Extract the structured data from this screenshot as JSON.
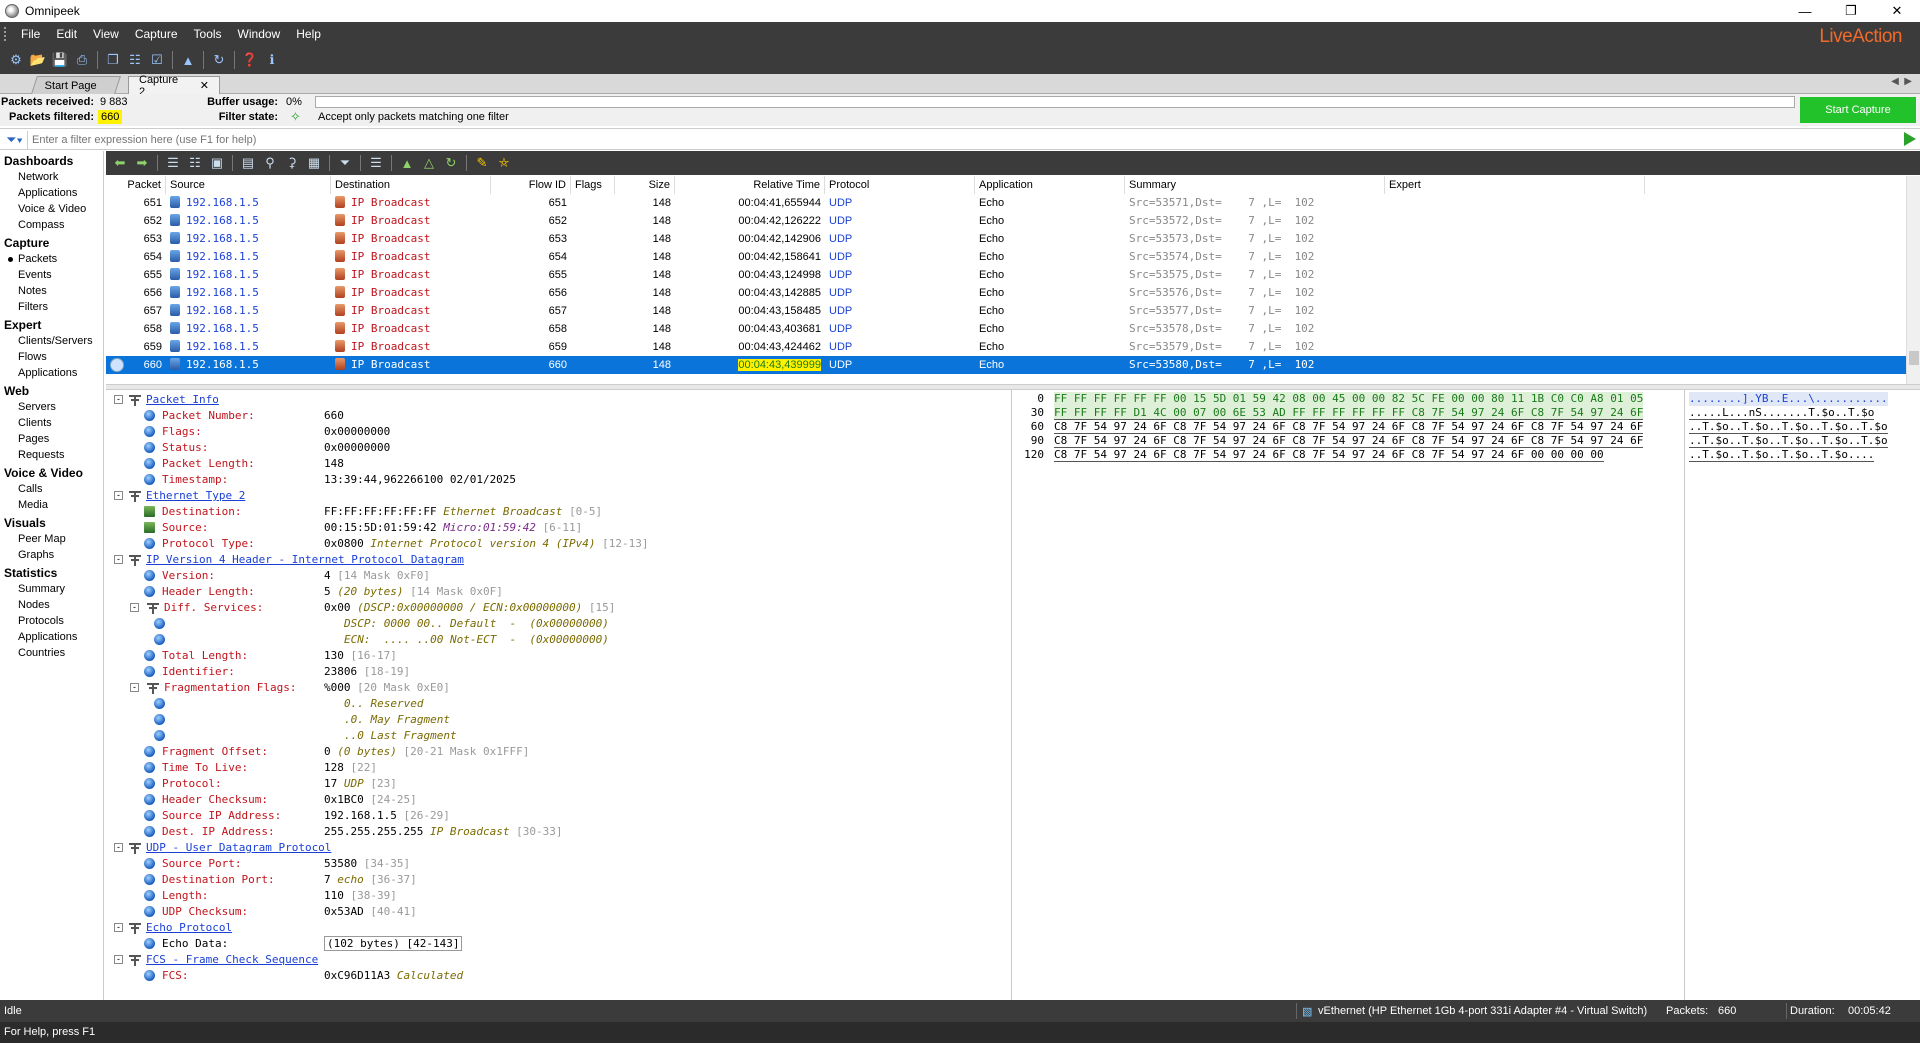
{
  "window": {
    "title": "Omnipeek",
    "brand": "LiveAction"
  },
  "menu": [
    "File",
    "Edit",
    "View",
    "Capture",
    "Tools",
    "Window",
    "Help"
  ],
  "tabs": {
    "start": "Start Page",
    "capture": "Capture 2"
  },
  "stats": {
    "received_label": "Packets received:",
    "received_value": "9 883",
    "filtered_label": "Packets filtered:",
    "filtered_value": "660",
    "buffer_label": "Buffer usage:",
    "buffer_value": "0%",
    "filterstate_label": "Filter state:",
    "filterstate_value": "Accept only packets matching one filter",
    "start_capture": "Start Capture"
  },
  "filter": {
    "placeholder": "Enter a filter expression here (use F1 for help)"
  },
  "sidebar": [
    {
      "section": "Dashboards",
      "items": [
        "Network",
        "Applications",
        "Voice & Video",
        "Compass"
      ]
    },
    {
      "section": "Capture",
      "items": [
        "Packets",
        "Events",
        "Notes",
        "Filters"
      ]
    },
    {
      "section": "Expert",
      "items": [
        "Clients/Servers",
        "Flows",
        "Applications"
      ]
    },
    {
      "section": "Web",
      "items": [
        "Servers",
        "Clients",
        "Pages",
        "Requests"
      ]
    },
    {
      "section": "Voice & Video",
      "items": [
        "Calls",
        "Media"
      ]
    },
    {
      "section": "Visuals",
      "items": [
        "Peer Map",
        "Graphs"
      ]
    },
    {
      "section": "Statistics",
      "items": [
        "Summary",
        "Nodes",
        "Protocols",
        "Applications",
        "Countries"
      ]
    }
  ],
  "sidebar_selected": "Packets",
  "packet_columns": [
    "Packet",
    "Source",
    "Destination",
    "Flow ID",
    "Flags",
    "Size",
    "Relative Time",
    "Protocol",
    "Application",
    "Summary",
    "Expert"
  ],
  "packets": [
    {
      "no": "651",
      "src": "192.168.1.5",
      "dst": "IP Broadcast",
      "flow": "651",
      "size": "148",
      "time": "00:04:41,655944",
      "proto": "UDP",
      "app": "Echo",
      "summary": "Src=53571,Dst=    7 ,L=  102"
    },
    {
      "no": "652",
      "src": "192.168.1.5",
      "dst": "IP Broadcast",
      "flow": "652",
      "size": "148",
      "time": "00:04:42,126222",
      "proto": "UDP",
      "app": "Echo",
      "summary": "Src=53572,Dst=    7 ,L=  102"
    },
    {
      "no": "653",
      "src": "192.168.1.5",
      "dst": "IP Broadcast",
      "flow": "653",
      "size": "148",
      "time": "00:04:42,142906",
      "proto": "UDP",
      "app": "Echo",
      "summary": "Src=53573,Dst=    7 ,L=  102"
    },
    {
      "no": "654",
      "src": "192.168.1.5",
      "dst": "IP Broadcast",
      "flow": "654",
      "size": "148",
      "time": "00:04:42,158641",
      "proto": "UDP",
      "app": "Echo",
      "summary": "Src=53574,Dst=    7 ,L=  102"
    },
    {
      "no": "655",
      "src": "192.168.1.5",
      "dst": "IP Broadcast",
      "flow": "655",
      "size": "148",
      "time": "00:04:43,124998",
      "proto": "UDP",
      "app": "Echo",
      "summary": "Src=53575,Dst=    7 ,L=  102"
    },
    {
      "no": "656",
      "src": "192.168.1.5",
      "dst": "IP Broadcast",
      "flow": "656",
      "size": "148",
      "time": "00:04:43,142885",
      "proto": "UDP",
      "app": "Echo",
      "summary": "Src=53576,Dst=    7 ,L=  102"
    },
    {
      "no": "657",
      "src": "192.168.1.5",
      "dst": "IP Broadcast",
      "flow": "657",
      "size": "148",
      "time": "00:04:43,158485",
      "proto": "UDP",
      "app": "Echo",
      "summary": "Src=53577,Dst=    7 ,L=  102"
    },
    {
      "no": "658",
      "src": "192.168.1.5",
      "dst": "IP Broadcast",
      "flow": "658",
      "size": "148",
      "time": "00:04:43,403681",
      "proto": "UDP",
      "app": "Echo",
      "summary": "Src=53578,Dst=    7 ,L=  102"
    },
    {
      "no": "659",
      "src": "192.168.1.5",
      "dst": "IP Broadcast",
      "flow": "659",
      "size": "148",
      "time": "00:04:43,424462",
      "proto": "UDP",
      "app": "Echo",
      "summary": "Src=53579,Dst=    7 ,L=  102"
    },
    {
      "no": "660",
      "src": "192.168.1.5",
      "dst": "IP Broadcast",
      "flow": "660",
      "size": "148",
      "time": "00:04:43,439999",
      "proto": "UDP",
      "app": "Echo",
      "summary": "Src=53580,Dst=    7 ,L=  102"
    }
  ],
  "selected_packet": "660",
  "decode": [
    {
      "lvl": 0,
      "kind": "head",
      "exp": "-",
      "text": "Packet Info"
    },
    {
      "lvl": 1,
      "kind": "field",
      "label": "Packet Number:",
      "value": "660"
    },
    {
      "lvl": 1,
      "kind": "field",
      "label": "Flags:",
      "value": "0x00000000"
    },
    {
      "lvl": 1,
      "kind": "field",
      "label": "Status:",
      "value": "0x00000000"
    },
    {
      "lvl": 1,
      "kind": "field",
      "label": "Packet Length:",
      "value": "148"
    },
    {
      "lvl": 1,
      "kind": "field",
      "label": "Timestamp:",
      "value": "13:39:44,962266100 02/01/2025"
    },
    {
      "lvl": 0,
      "kind": "head",
      "exp": "-",
      "text": "Ethernet Type 2"
    },
    {
      "lvl": 1,
      "kind": "field",
      "icon": "nic",
      "label": "Destination:",
      "value": "FF:FF:FF:FF:FF:FF",
      "note": "Ethernet Broadcast",
      "range": "[0-5]"
    },
    {
      "lvl": 1,
      "kind": "field",
      "icon": "nic",
      "label": "Source:",
      "value": "00:15:5D:01:59:42",
      "note": "Micro:01:59:42",
      "notecolor": "purple",
      "range": "[6-11]"
    },
    {
      "lvl": 1,
      "kind": "field",
      "label": "Protocol Type:",
      "value": "0x0800",
      "note": "Internet Protocol version 4 (IPv4)",
      "range": "[12-13]"
    },
    {
      "lvl": 0,
      "kind": "head",
      "exp": "-",
      "text": "IP Version 4 Header - Internet Protocol Datagram"
    },
    {
      "lvl": 1,
      "kind": "field",
      "label": "Version:",
      "value": "4",
      "range": "[14 Mask 0xF0]"
    },
    {
      "lvl": 1,
      "kind": "field",
      "label": "Header Length:",
      "value": "5",
      "note": "(20 bytes)",
      "range": "[14 Mask 0x0F]"
    },
    {
      "lvl": 1,
      "kind": "fieldexp",
      "exp": "-",
      "label": "Diff. Services:",
      "value": "0x00",
      "note": "(DSCP:0x00000000 / ECN:0x00000000)",
      "range": "[15]"
    },
    {
      "lvl": 2,
      "kind": "sub",
      "note": "DSCP: 0000 00.. Default  -  (0x00000000)"
    },
    {
      "lvl": 2,
      "kind": "sub",
      "note": "ECN:  .... ..00 Not-ECT  -  (0x00000000)"
    },
    {
      "lvl": 1,
      "kind": "field",
      "label": "Total Length:",
      "value": "130",
      "range": "[16-17]"
    },
    {
      "lvl": 1,
      "kind": "field",
      "label": "Identifier:",
      "value": "23806",
      "range": "[18-19]"
    },
    {
      "lvl": 1,
      "kind": "fieldexp",
      "exp": "-",
      "label": "Fragmentation Flags:",
      "value": "%000",
      "range": "[20 Mask 0xE0]"
    },
    {
      "lvl": 2,
      "kind": "sub",
      "note": "0.. Reserved"
    },
    {
      "lvl": 2,
      "kind": "sub",
      "note": ".0. May Fragment"
    },
    {
      "lvl": 2,
      "kind": "sub",
      "note": "..0 Last Fragment"
    },
    {
      "lvl": 1,
      "kind": "field",
      "label": "Fragment Offset:",
      "value": "0",
      "note": "(0 bytes)",
      "range": "[20-21 Mask 0x1FFF]"
    },
    {
      "lvl": 1,
      "kind": "field",
      "label": "Time To Live:",
      "value": "128",
      "range": "[22]"
    },
    {
      "lvl": 1,
      "kind": "field",
      "label": "Protocol:",
      "value": "17",
      "note": "UDP",
      "range": "[23]"
    },
    {
      "lvl": 1,
      "kind": "field",
      "label": "Header Checksum:",
      "value": "0x1BC0",
      "range": "[24-25]"
    },
    {
      "lvl": 1,
      "kind": "field",
      "icon": "ip",
      "label": "Source IP Address:",
      "value": "192.168.1.5",
      "range": "[26-29]"
    },
    {
      "lvl": 1,
      "kind": "field",
      "icon": "ip",
      "label": "Dest. IP Address:",
      "value": "255.255.255.255",
      "note": "IP Broadcast",
      "range": "[30-33]"
    },
    {
      "lvl": 0,
      "kind": "head",
      "exp": "-",
      "text": "UDP - User Datagram Protocol"
    },
    {
      "lvl": 1,
      "kind": "field",
      "label": "Source Port:",
      "value": "53580",
      "range": "[34-35]"
    },
    {
      "lvl": 1,
      "kind": "field",
      "label": "Destination Port:",
      "value": "7",
      "note": "echo",
      "range": "[36-37]"
    },
    {
      "lvl": 1,
      "kind": "field",
      "label": "Length:",
      "value": "110",
      "range": "[38-39]"
    },
    {
      "lvl": 1,
      "kind": "field",
      "label": "UDP Checksum:",
      "value": "0x53AD",
      "range": "[40-41]"
    },
    {
      "lvl": 0,
      "kind": "head",
      "exp": "-",
      "text": "Echo Protocol"
    },
    {
      "lvl": 1,
      "kind": "field",
      "boxed": true,
      "label": "Echo Data:",
      "value": "(102 bytes) [42-143]"
    },
    {
      "lvl": 0,
      "kind": "head",
      "exp": "-",
      "text": "FCS - Frame Check Sequence"
    },
    {
      "lvl": 1,
      "kind": "field",
      "label": "FCS:",
      "value": "0xC96D11A3",
      "note": "Calculated"
    }
  ],
  "hex": [
    {
      "off": "0",
      "bytes": "FF FF FF FF FF FF 00 15 5D 01 59 42 08 00 45 00 00 82 5C FE 00 00 80 11 1B C0 C0 A8 01 05",
      "ascii": "........].YB..E...\\..........."
    },
    {
      "off": "30",
      "bytes": "FF FF FF FF D1 4C 00 07 00 6E 53 AD FF FF FF FF FF FF C8 7F 54 97 24 6F C8 7F 54 97 24 6F",
      "ascii": ".....L...nS.......T.$o..T.$o"
    },
    {
      "off": "60",
      "bytes": "C8 7F 54 97 24 6F C8 7F 54 97 24 6F C8 7F 54 97 24 6F C8 7F 54 97 24 6F C8 7F 54 97 24 6F",
      "ascii": "..T.$o..T.$o..T.$o..T.$o..T.$o"
    },
    {
      "off": "90",
      "bytes": "C8 7F 54 97 24 6F C8 7F 54 97 24 6F C8 7F 54 97 24 6F C8 7F 54 97 24 6F C8 7F 54 97 24 6F",
      "ascii": "..T.$o..T.$o..T.$o..T.$o..T.$o"
    },
    {
      "off": "120",
      "bytes": "C8 7F 54 97 24 6F C8 7F 54 97 24 6F C8 7F 54 97 24 6F C8 7F 54 97 24 6F 00 00 00 00",
      "ascii": "..T.$o..T.$o..T.$o..T.$o...."
    }
  ],
  "status": {
    "state": "Idle",
    "adapter": "vEthernet (HP Ethernet 1Gb 4-port 331i Adapter #4 - Virtual Switch)",
    "packets_label": "Packets:",
    "packets_value": "660",
    "duration_label": "Duration:",
    "duration_value": "00:05:42",
    "help": "For Help, press F1"
  },
  "colors": {
    "accent_green": "#22c22a",
    "selection": "#0a74da",
    "highlight": "#fff200",
    "brand_orange": "#f26a2a"
  }
}
